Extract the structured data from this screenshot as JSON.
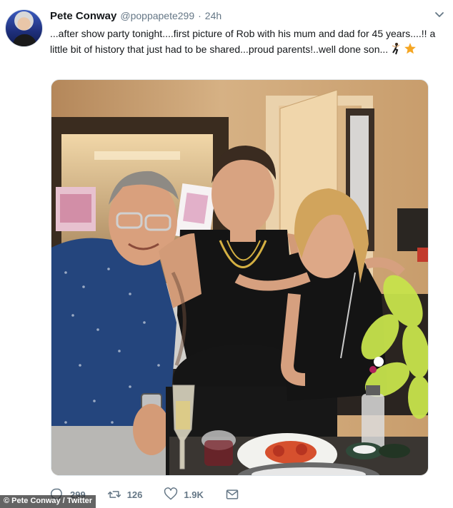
{
  "tweet": {
    "display_name": "Pete Conway",
    "handle": "@poppapete299",
    "separator": "·",
    "time": "24h",
    "text": "...after show party tonight....first picture of Rob with his mum and dad for 45 years....!! a little bit of history that just had to be shared...proud parents!..well done son...",
    "emoji": [
      "dancer-emoji",
      "star-emoji"
    ]
  },
  "actions": {
    "reply_count": "299",
    "retweet_count": "126",
    "like_count": "1.9K"
  },
  "credit": "© Pete Conway / Twitter",
  "colors": {
    "text": "#14171a",
    "muted": "#657786",
    "border": "#e1e8ed",
    "star": "#f5a623"
  },
  "icons": {
    "reply": "reply-icon",
    "retweet": "retweet-icon",
    "like": "heart-icon",
    "dm": "envelope-icon",
    "caret": "chevron-down-icon"
  }
}
